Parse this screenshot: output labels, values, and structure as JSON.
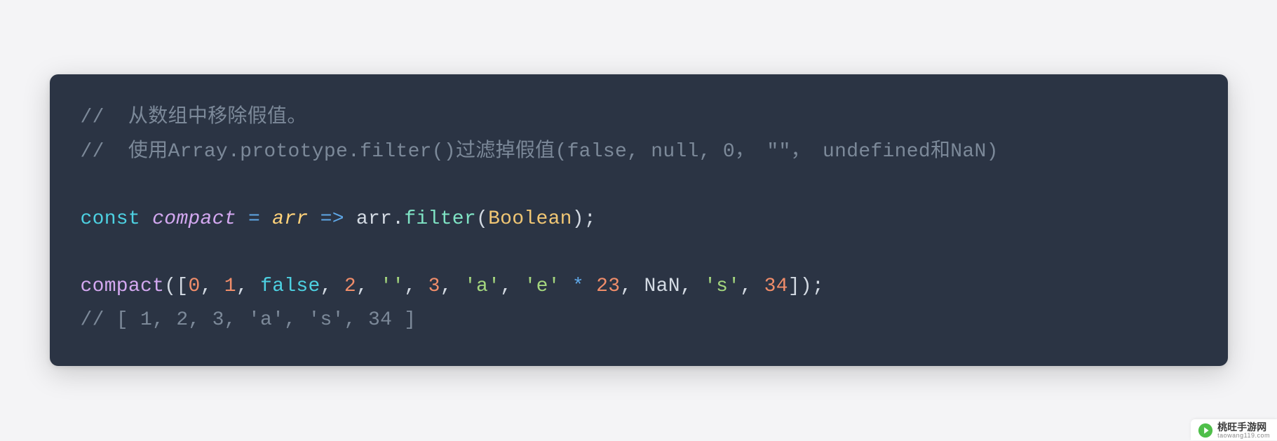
{
  "code": {
    "line1": {
      "comment_prefix": "// ",
      "comment_text": " 从数组中移除假值。"
    },
    "line2": {
      "comment_prefix": "// ",
      "comment_text": " 使用Array.prototype.filter()过滤掉假值(false, null, 0， \"\"， undefined和NaN)"
    },
    "line4": {
      "keyword": "const",
      "name": "compact",
      "eq": " = ",
      "param": "arr",
      "arrow": " => ",
      "arr": "arr",
      "dot": ".",
      "method": "filter",
      "open": "(",
      "type": "Boolean",
      "close": ")",
      "semi": ";"
    },
    "line6": {
      "fn": "compact",
      "open": "([",
      "v0": "0",
      "c": ", ",
      "v1": "1",
      "false": "false",
      "v2": "2",
      "empty": "''",
      "v3": "3",
      "sa": "'a'",
      "se": "'e'",
      "mul": " * ",
      "v23": "23",
      "nan": "NaN",
      "ss": "'s'",
      "v34": "34",
      "close": "]);"
    },
    "line7": {
      "text": "// [ 1, 2, 3, 'a', 's', 34 ]"
    }
  },
  "watermark": {
    "name": "桃旺手游网",
    "url": "taowang119.com"
  }
}
